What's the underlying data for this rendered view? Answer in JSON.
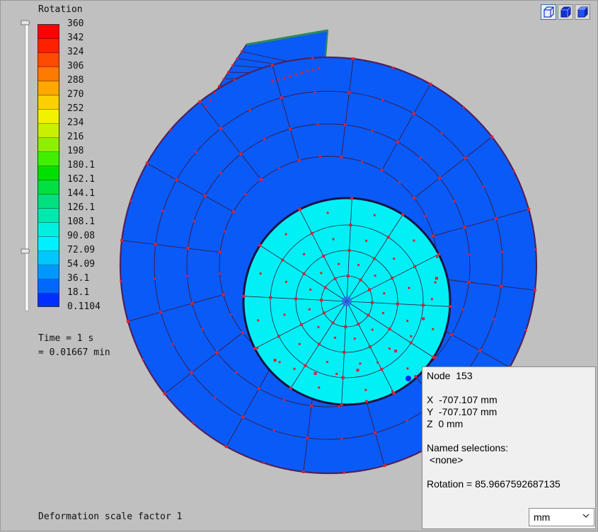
{
  "legend": {
    "title": "Rotation",
    "ticks": [
      "360",
      "342",
      "324",
      "306",
      "288",
      "270",
      "252",
      "234",
      "216",
      "198",
      "180.1",
      "162.1",
      "144.1",
      "126.1",
      "108.1",
      "90.08",
      "72.09",
      "54.09",
      "36.1",
      "18.1",
      "0.1104"
    ],
    "band_colors": [
      "#ff0000",
      "#ff2000",
      "#ff4a00",
      "#ff7a00",
      "#ffa800",
      "#ffd000",
      "#f2f200",
      "#c8f000",
      "#8cf000",
      "#40f000",
      "#00e000",
      "#00e040",
      "#00e080",
      "#00e8b0",
      "#00f0e0",
      "#00f0ff",
      "#00c8ff",
      "#0098ff",
      "#0068ff",
      "#0030ff"
    ]
  },
  "time": {
    "line1": "Time = 1 s",
    "line2": "= 0.01667 min"
  },
  "footer": {
    "deformation": "Deformation scale factor 1"
  },
  "view_buttons": [
    "wireframe-cube-icon",
    "solid-cube-icon",
    "shaded-cube-icon"
  ],
  "colors": {
    "outer_ring": "#0a5af8",
    "inner_disk": "#00f0f5",
    "mesh_line": "#3a1a40",
    "node": "#e02030",
    "selected_node": "#0020ff"
  },
  "node_info": {
    "title": "Node  153",
    "x": "X  -707.107 mm",
    "y": "Y  -707.107 mm",
    "z": "Z  0 mm",
    "named_label": "Named selections:",
    "named_value": " <none>",
    "result": "Rotation = 85.9667592687135",
    "units": "mm"
  }
}
